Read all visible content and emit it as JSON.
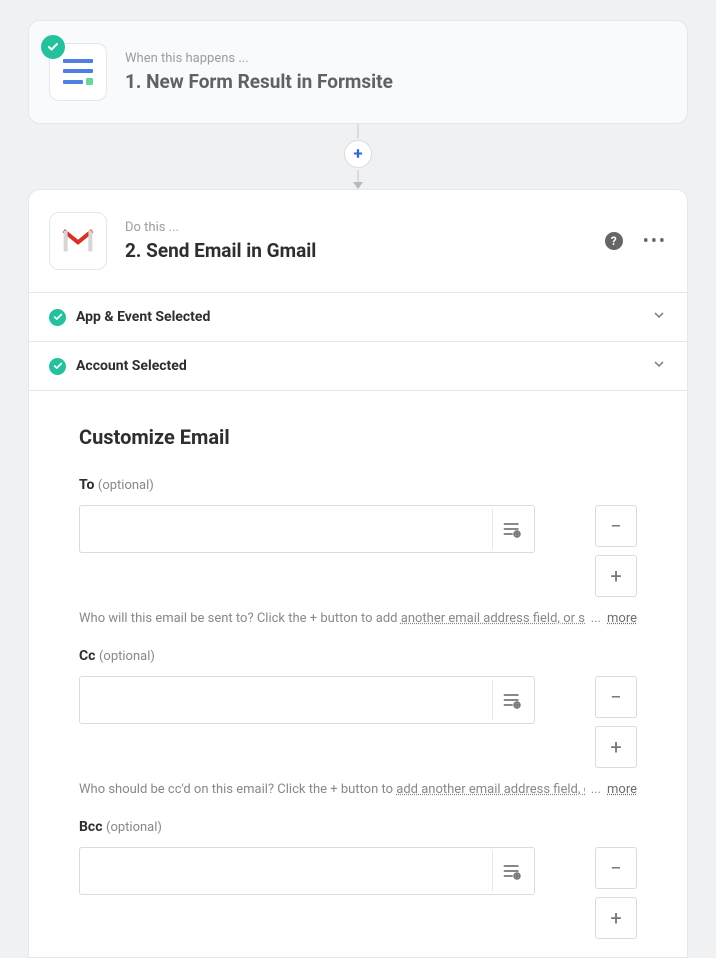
{
  "step1": {
    "eyebrow": "When this happens ...",
    "title": "1. New Form Result in Formsite",
    "iconColors": {
      "line": "#4f7fe0",
      "accent": "#65d6a2"
    }
  },
  "step2": {
    "eyebrow": "Do this ...",
    "title": "2. Send Email in Gmail"
  },
  "sections": {
    "appEvent": "App & Event Selected",
    "account": "Account Selected"
  },
  "form": {
    "title": "Customize Email",
    "optionalLabel": "(optional)",
    "moreLabel": "more",
    "fields": {
      "to": {
        "label": "To",
        "help_full": "Who will this email be sent to? Click the + button to add another email address field, or separate with a comma.",
        "help_visible": "Who will this email be sent to? Click the + button to add ",
        "help_underlined": "another email address field, or sep"
      },
      "cc": {
        "label": "Cc",
        "help_visible": "Who should be cc'd on this email? Click the + button to ",
        "help_underlined": "add another email address field, or"
      },
      "bcc": {
        "label": "Bcc"
      }
    }
  }
}
